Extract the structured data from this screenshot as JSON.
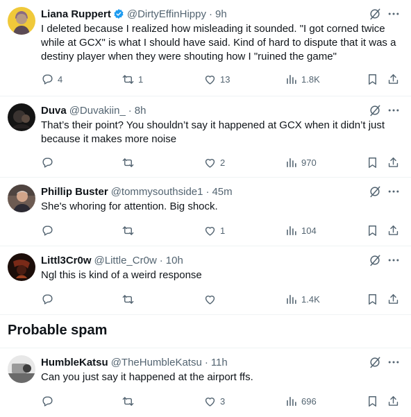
{
  "replies": [
    {
      "name": "Liana Ruppert",
      "handle": "@DirtyEffinHippy",
      "time": "9h",
      "text": "I deleted because I realized how misleading it sounded. \"I got corned twice while at GCX\" is what I should have said. Kind of hard to dispute that it was a destiny player when they were shouting how I \"ruined the game\"",
      "replies_count": "4",
      "reposts": "1",
      "likes": "13",
      "views": "1.8K"
    },
    {
      "name": "Duva",
      "handle": "@Duvakiin_",
      "time": "8h",
      "text": "That’s their point? You shouldn’t say it happened at GCX when it didn’t just because it makes more noise",
      "replies_count": "",
      "reposts": "",
      "likes": "2",
      "views": "970"
    },
    {
      "name": "Phillip Buster",
      "handle": "@tommysouthside1",
      "time": "45m",
      "text": "She's whoring for attention. Big shock.",
      "replies_count": "",
      "reposts": "",
      "likes": "1",
      "views": "104"
    },
    {
      "name": "Littl3Cr0w",
      "handle": "@Little_Cr0w",
      "time": "10h",
      "text": "Ngl this is kind of a weird response",
      "replies_count": "",
      "reposts": "",
      "likes": "",
      "views": "1.4K"
    },
    {
      "name": "HumbleKatsu",
      "handle": "@TheHumbleKatsu",
      "time": "11h",
      "text": "Can you just say it happened at the airport ffs.",
      "replies_count": "",
      "reposts": "",
      "likes": "3",
      "views": "696"
    }
  ],
  "section": {
    "spam_title": "Probable spam"
  },
  "separator": "·",
  "colors": {
    "text": "#0f1419",
    "muted": "#536471",
    "verified": "#1d9bf0",
    "divider": "#eff3f4"
  },
  "icons": [
    "verified-badge-icon",
    "grok-icon",
    "more-icon",
    "reply-icon",
    "repost-icon",
    "like-icon",
    "views-icon",
    "bookmark-icon",
    "share-icon"
  ]
}
